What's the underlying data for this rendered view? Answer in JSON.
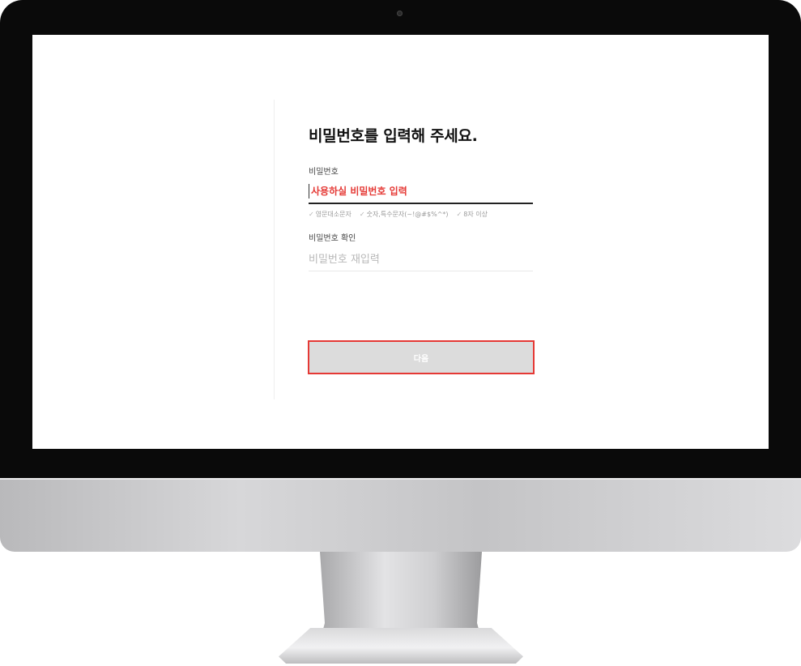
{
  "page": {
    "title": "비밀번호를 입력해 주세요."
  },
  "password_field": {
    "label": "비밀번호",
    "placeholder": "사용하실 비밀번호 입력",
    "rules": [
      "영문대소문자",
      "숫자,특수문자(~!@#$%^*)",
      "8자 이상"
    ]
  },
  "confirm_field": {
    "label": "비밀번호 확인",
    "placeholder": "비밀번호 재입력"
  },
  "next_button": {
    "label": "다음"
  },
  "colors": {
    "accent": "#e53935",
    "button_disabled": "#dcdcdc",
    "bezel": "#0a0a0a"
  },
  "icons": {
    "rule_check": "check-icon"
  }
}
